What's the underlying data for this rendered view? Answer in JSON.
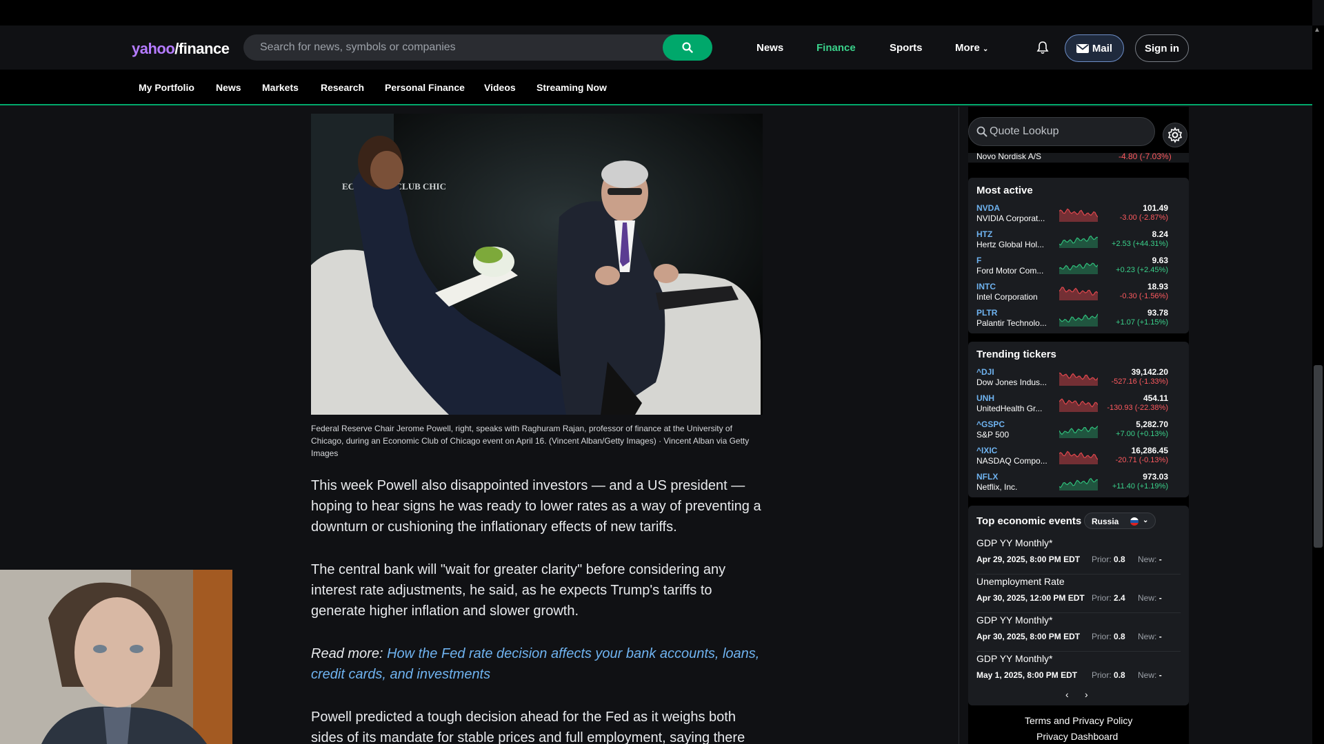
{
  "header": {
    "logo_yahoo": "yahoo",
    "logo_finance": "/finance",
    "search_placeholder": "Search for news, symbols or companies",
    "nav": [
      "News",
      "Finance",
      "Sports",
      "More"
    ],
    "active_nav": "Finance",
    "mail_label": "Mail",
    "signin_label": "Sign in"
  },
  "subnav": [
    "My Portfolio",
    "News",
    "Markets",
    "Research",
    "Personal Finance",
    "Videos",
    "Streaming Now"
  ],
  "article": {
    "image_text": "ECONOMIC CLUB CHIC",
    "caption": "Federal Reserve Chair Jerome Powell, right, speaks with Raghuram Rajan, professor of finance at the University of Chicago, during an Economic Club of Chicago event on April 16. (Vincent Alban/Getty Images) · Vincent Alban via Getty Images",
    "p1": "This week Powell also disappointed investors — and a US president — hoping to hear signs he was ready to lower rates as a way of preventing a downturn or cushioning the inflationary effects of new tariffs.",
    "p2": "The central bank will \"wait for greater clarity\" before considering any interest rate adjustments, he said, as he expects Trump's tariffs to generate higher inflation and slower growth.",
    "read_more_label": "Read more:",
    "read_more_link": "How the Fed rate decision affects your bank accounts, loans, credit cards, and investments",
    "p3": "Powell predicted a tough decision ahead for the Fed as it weighs both sides of its mandate for stable prices and full employment, saying there"
  },
  "sidebar": {
    "quote_placeholder": "Quote Lookup",
    "partial_row": {
      "name": "Novo Nordisk A/S",
      "change": "-4.80 (-7.03%)"
    },
    "most_active": {
      "title": "Most active",
      "rows": [
        {
          "symbol": "NVDA",
          "name": "NVIDIA Corporat...",
          "price": "101.49",
          "change": "-3.00 (-2.87%)",
          "dir": "neg"
        },
        {
          "symbol": "HTZ",
          "name": "Hertz Global Hol...",
          "price": "8.24",
          "change": "+2.53 (+44.31%)",
          "dir": "pos"
        },
        {
          "symbol": "F",
          "name": "Ford Motor Com...",
          "price": "9.63",
          "change": "+0.23 (+2.45%)",
          "dir": "pos"
        },
        {
          "symbol": "INTC",
          "name": "Intel Corporation",
          "price": "18.93",
          "change": "-0.30 (-1.56%)",
          "dir": "neg"
        },
        {
          "symbol": "PLTR",
          "name": "Palantir Technolo...",
          "price": "93.78",
          "change": "+1.07 (+1.15%)",
          "dir": "pos"
        }
      ]
    },
    "trending": {
      "title": "Trending tickers",
      "rows": [
        {
          "symbol": "^DJI",
          "name": "Dow Jones Indus...",
          "price": "39,142.20",
          "change": "-527.16 (-1.33%)",
          "dir": "neg"
        },
        {
          "symbol": "UNH",
          "name": "UnitedHealth Gr...",
          "price": "454.11",
          "change": "-130.93 (-22.38%)",
          "dir": "neg"
        },
        {
          "symbol": "^GSPC",
          "name": "S&P 500",
          "price": "5,282.70",
          "change": "+7.00 (+0.13%)",
          "dir": "pos"
        },
        {
          "symbol": "^IXIC",
          "name": "NASDAQ Compo...",
          "price": "16,286.45",
          "change": "-20.71 (-0.13%)",
          "dir": "neg"
        },
        {
          "symbol": "NFLX",
          "name": "Netflix, Inc.",
          "price": "973.03",
          "change": "+11.40 (+1.19%)",
          "dir": "pos"
        }
      ]
    },
    "events": {
      "title": "Top economic events",
      "country": "Russia",
      "prior_label": "Prior:",
      "new_label": "New:",
      "rows": [
        {
          "name": "GDP YY Monthly*",
          "date": "Apr 29, 2025, 8:00 PM EDT",
          "prior": "0.8",
          "new": "-"
        },
        {
          "name": "Unemployment Rate",
          "date": "Apr 30, 2025, 12:00 PM EDT",
          "prior": "2.4",
          "new": "-"
        },
        {
          "name": "GDP YY Monthly*",
          "date": "Apr 30, 2025, 8:00 PM EDT",
          "prior": "0.8",
          "new": "-"
        },
        {
          "name": "GDP YY Monthly*",
          "date": "May 1, 2025, 8:00 PM EDT",
          "prior": "0.8",
          "new": "-"
        }
      ],
      "prev": "‹",
      "next": "›"
    },
    "footer": [
      "Terms and Privacy Policy",
      "Privacy Dashboard"
    ]
  },
  "colors": {
    "accent": "#00a86b",
    "positive": "#3ad28b",
    "negative": "#ff5a5f",
    "link": "#6fb3f0",
    "brand_purple": "#b57bff"
  }
}
